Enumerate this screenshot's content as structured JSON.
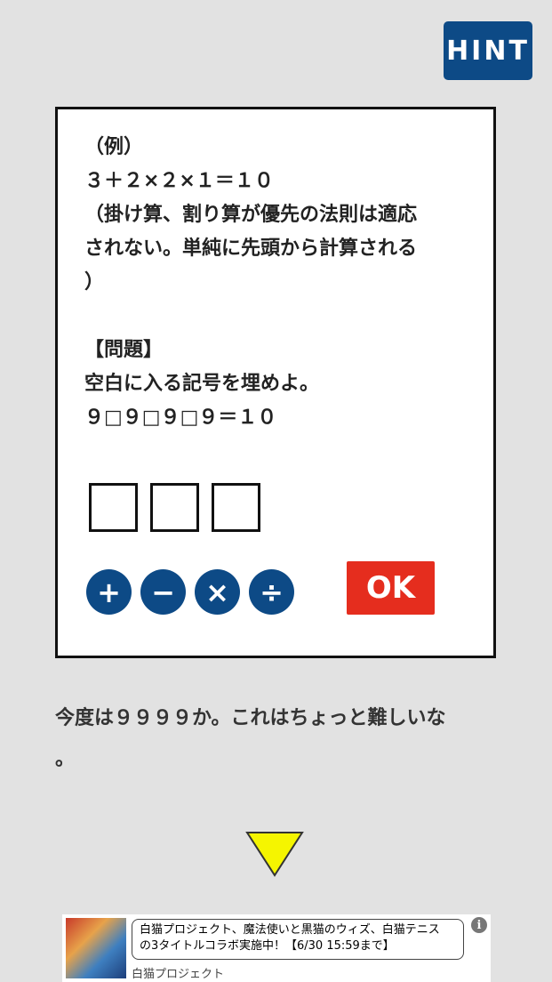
{
  "hint_button": {
    "label": "HINT",
    "color": "#0d4a86"
  },
  "puzzle": {
    "lines": [
      "（例）",
      "３＋２×２×１＝１０",
      "（掛け算、割り算が優先の法則は適応",
      "されない。単純に先頭から計算される",
      "）",
      "",
      "【問題】",
      "空白に入る記号を埋めよ。",
      "９□９□９□９＝１０"
    ],
    "answer_slots": [
      "",
      "",
      ""
    ]
  },
  "operators": [
    {
      "name": "plus",
      "symbol": "+"
    },
    {
      "name": "minus",
      "symbol": "−"
    },
    {
      "name": "multiply",
      "symbol": "×"
    },
    {
      "name": "divide",
      "symbol": "÷"
    }
  ],
  "ok_button": {
    "label": "OK",
    "color": "#e52d1e"
  },
  "dialogue": {
    "lines": [
      "今度は９９９９か。これはちょっと難しいな",
      "。"
    ]
  },
  "next_arrow": {
    "icon": "triangle-down-icon",
    "color": "#f5f500"
  },
  "ad": {
    "text_line1": "白猫プロジェクト、魔法使いと黒猫のウィズ、白猫テニス",
    "text_line2": "の3タイトルコラボ実施中！【6/30 15:59まで】",
    "source": "白猫プロジェクト",
    "info_icon": "info-icon"
  }
}
